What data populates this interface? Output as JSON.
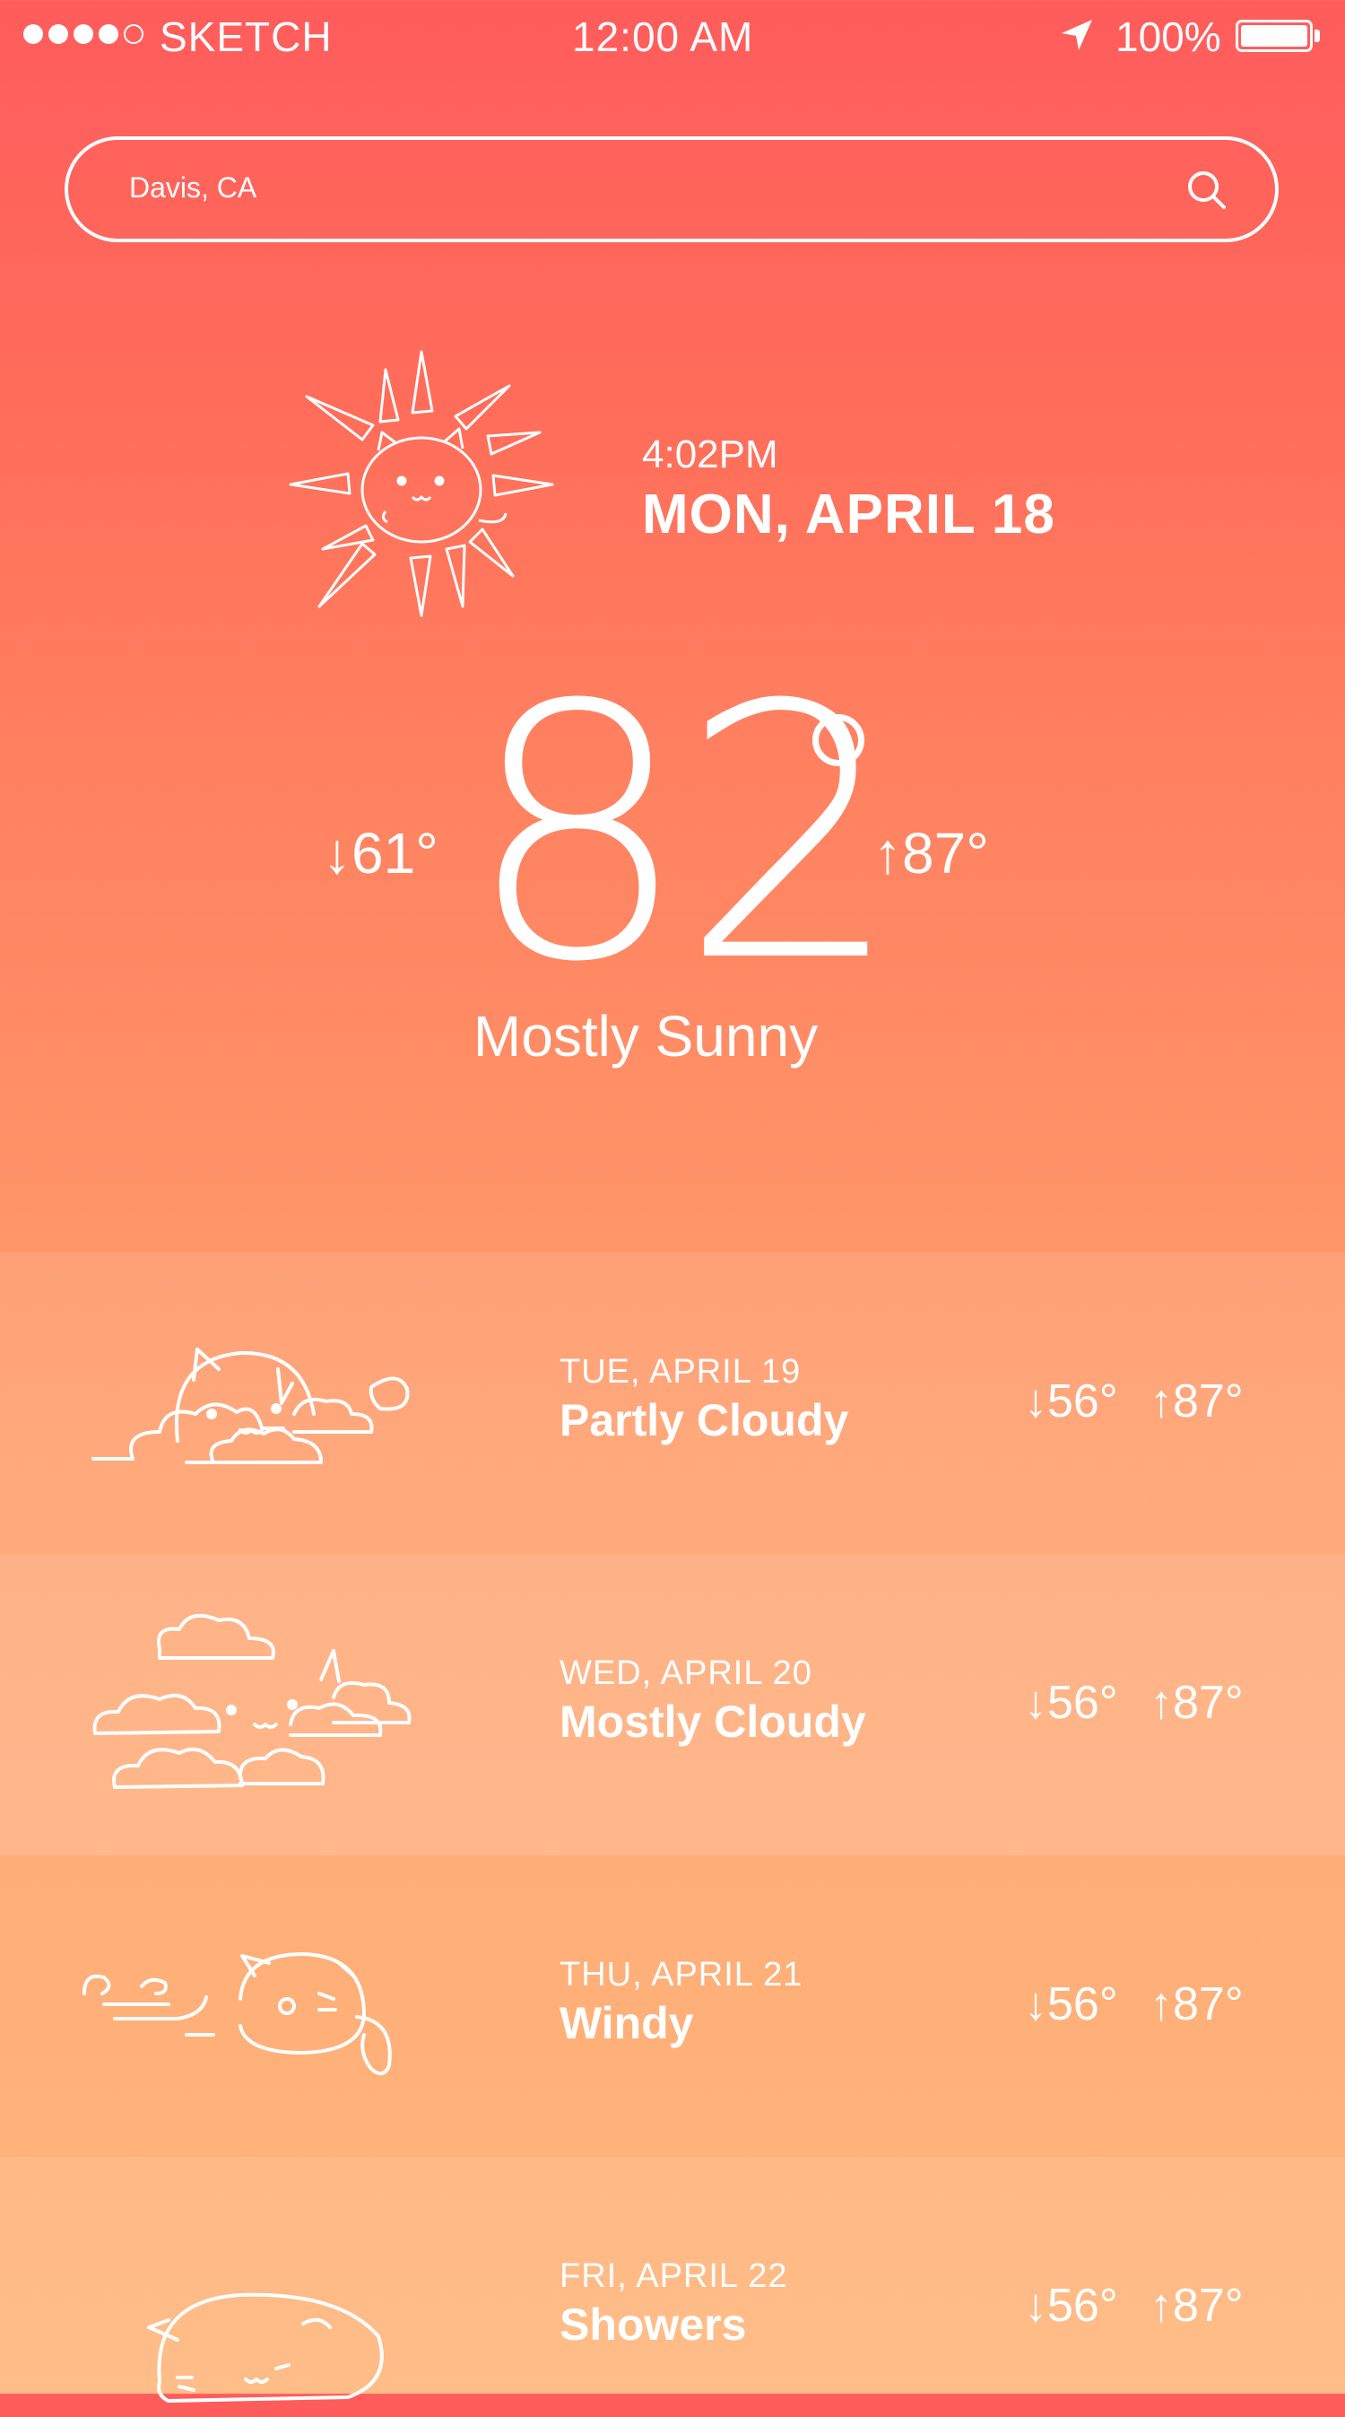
{
  "status_bar": {
    "carrier": "SKETCH",
    "time": "12:00 AM",
    "battery": "100%"
  },
  "search": {
    "value": "Davis, CA",
    "icon": "search-icon"
  },
  "current": {
    "time": "4:02PM",
    "date": "MON, APRIL 18",
    "temperature": "82",
    "low": "↓61°",
    "high": "↑87°",
    "condition": "Mostly Sunny",
    "icon": "sunny-cat-icon"
  },
  "forecast": [
    {
      "date": "TUE, APRIL 19",
      "condition": "Partly Cloudy",
      "low": "↓56°",
      "high": "↑87°",
      "icon": "partly-cloudy-cat-icon"
    },
    {
      "date": "WED, APRIL 20",
      "condition": "Mostly Cloudy",
      "low": "↓56°",
      "high": "↑87°",
      "icon": "mostly-cloudy-cat-icon"
    },
    {
      "date": "THU, APRIL 21",
      "condition": "Windy",
      "low": "↓56°",
      "high": "↑87°",
      "icon": "windy-cat-icon"
    },
    {
      "date": "FRI, APRIL 22",
      "condition": "Showers",
      "low": "↓56°",
      "high": "↑87°",
      "icon": "showers-cat-icon"
    }
  ],
  "colors": {
    "background_top": "#ff5c5c",
    "background_bottom": "#ffb478",
    "foreground": "#ffffff"
  }
}
